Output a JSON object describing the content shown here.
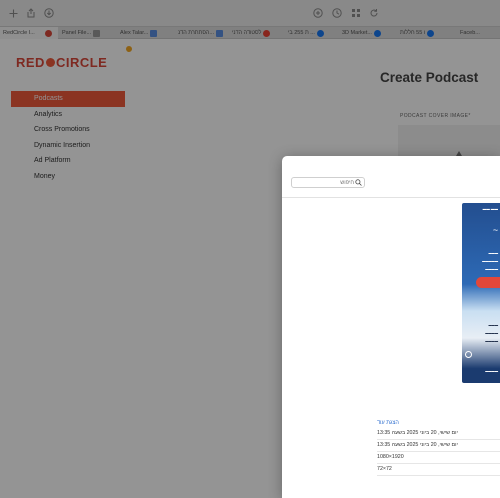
{
  "browser": {
    "tabs": [
      {
        "label": "RedCircle I...",
        "fav_color": "#d9473a",
        "active": true
      },
      {
        "label": "Panel File...",
        "fav_color": "#999999",
        "active": false
      },
      {
        "label": "Alex Talar...",
        "fav_color": "#5b8de0",
        "active": false
      },
      {
        "label": "הסתתרת הדנ...",
        "fav_color": "#5b8de0",
        "active": false
      },
      {
        "label": "לסטודה הדני",
        "fav_color": "#ea4335",
        "active": false
      },
      {
        "label": "ת 255 בי ...",
        "fav_color": "#1877f2",
        "active": false
      },
      {
        "label": "3D Market...",
        "fav_color": "#1877f2",
        "active": false
      },
      {
        "label": "ו 55 חללות",
        "fav_color": "#1877f2",
        "active": false
      },
      {
        "label": "Faceb...",
        "fav_color": "#1877f2",
        "active": false
      }
    ]
  },
  "app": {
    "logo_text_left": "RED",
    "logo_text_right": "CIRCLE",
    "nav": [
      {
        "label": "Podcasts",
        "active": true
      },
      {
        "label": "Analytics",
        "active": false
      },
      {
        "label": "Cross Promotions",
        "active": false
      },
      {
        "label": "Dynamic Insertion",
        "active": false
      },
      {
        "label": "Ad Platform",
        "active": false
      },
      {
        "label": "Money",
        "active": false
      }
    ],
    "card": {
      "title": "Create Podcast",
      "cover_label": "PODCAST COVER IMAGE*"
    }
  },
  "dialog": {
    "search_placeholder": "חיפוש",
    "details_link": "הצגת עוד",
    "created": "יום שישי, 20 ביוני 2025 בשעה 13:35",
    "modified": "יום שישי, 20 ביוני 2025 בשעה 13:35",
    "dimensions": "1080×1920",
    "resolution": "72×72"
  }
}
